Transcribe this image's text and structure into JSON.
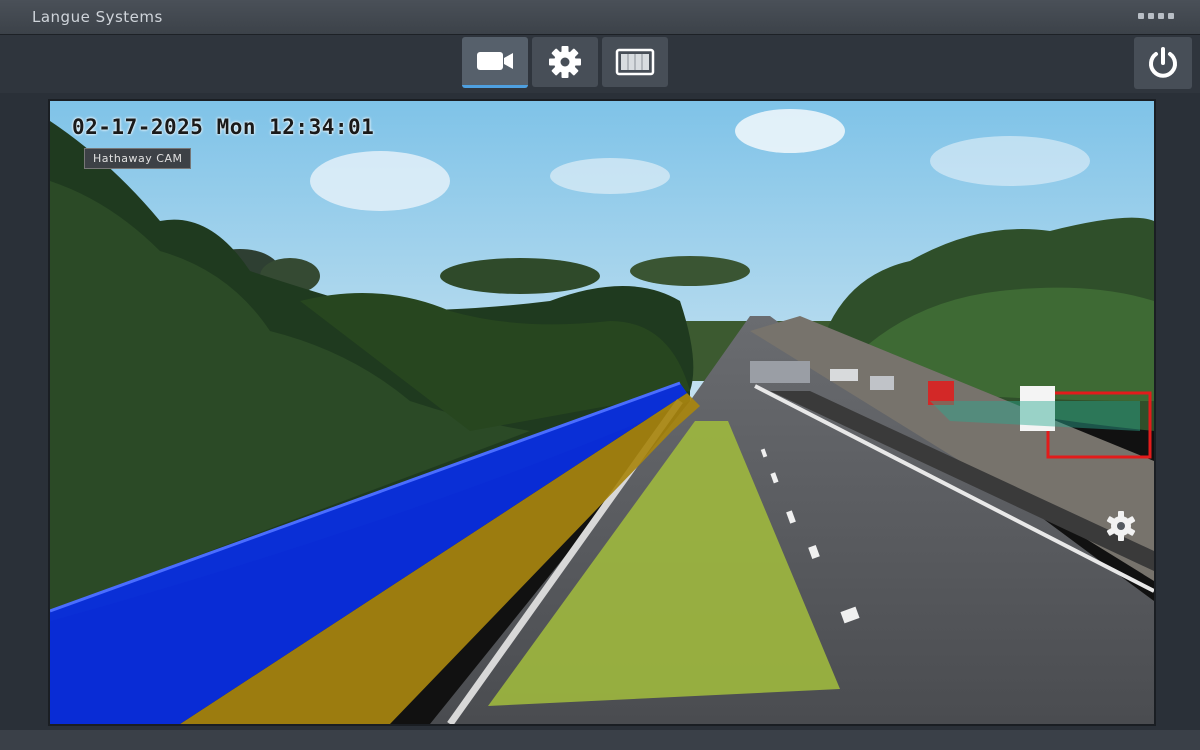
{
  "window": {
    "title": "Langue Systems"
  },
  "toolbar": {
    "buttons": [
      {
        "icon": "video-camera-icon",
        "active": true
      },
      {
        "icon": "gear-icon",
        "active": false
      },
      {
        "icon": "display-panel-icon",
        "active": false
      }
    ],
    "power_icon": "power-icon"
  },
  "camera": {
    "timestamp": "02-17-2025 Mon 12:34:01",
    "channel_label": "Hathaway CAM",
    "overlays": [
      {
        "name": "barrier-zone",
        "color": "#0a2ee0"
      },
      {
        "name": "median-zone",
        "color": "#a8860f"
      },
      {
        "name": "lane-zone",
        "color": "#9fb83e"
      },
      {
        "name": "detection-box",
        "color": "#e31b1b"
      }
    ]
  },
  "colors": {
    "window_bg": "#2a3038",
    "active_accent": "#4ea0e0",
    "toolbar_button": "#474e57"
  }
}
